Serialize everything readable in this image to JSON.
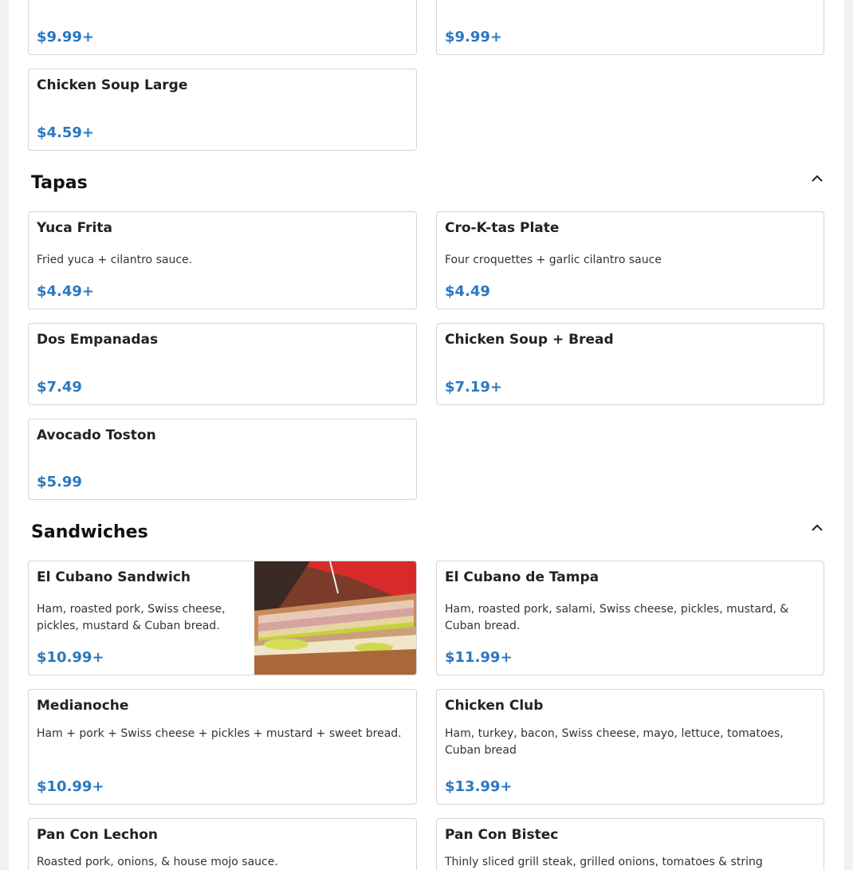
{
  "top_cards": [
    {
      "price": "$9.99+"
    },
    {
      "price": "$9.99+"
    }
  ],
  "soups_extra": {
    "name": "Chicken Soup Large",
    "price": "$4.59+"
  },
  "tapas": {
    "title": "Tapas",
    "items": [
      {
        "name": "Yuca Frita",
        "desc": "Fried yuca + cilantro sauce.",
        "price": "$4.49+"
      },
      {
        "name": "Cro-K-tas Plate",
        "desc": "Four croquettes + garlic cilantro sauce",
        "price": "$4.49"
      },
      {
        "name": "Dos Empanadas",
        "desc": "",
        "price": "$7.49"
      },
      {
        "name": "Chicken Soup + Bread",
        "desc": "",
        "price": "$7.19+"
      },
      {
        "name": "Avocado Toston",
        "desc": "",
        "price": "$5.99"
      }
    ]
  },
  "sandwiches": {
    "title": "Sandwiches",
    "items": [
      {
        "name": "El Cubano Sandwich",
        "desc": "Ham, roasted pork, Swiss cheese, pickles, mustard & Cuban bread.",
        "price": "$10.99+"
      },
      {
        "name": "El Cubano de Tampa",
        "desc": "Ham, roasted pork, salami, Swiss cheese, pickles, mustard, & Cuban bread.",
        "price": "$11.99+"
      },
      {
        "name": "Medianoche",
        "desc": "Ham + pork + Swiss cheese + pickles + mustard + sweet bread.",
        "price": "$10.99+"
      },
      {
        "name": "Chicken Club",
        "desc": "Ham, turkey, bacon, Swiss cheese, mayo, lettuce, tomatoes, Cuban bread",
        "price": "$13.99+"
      },
      {
        "name": "Pan Con Lechon",
        "desc": "Roasted pork, onions, & house mojo sauce.",
        "price": ""
      },
      {
        "name": "Pan Con Bistec",
        "desc": "Thinly sliced grill steak, grilled onions, tomatoes & string",
        "price": ""
      }
    ]
  },
  "icons": {
    "collapse": "chevron-up-icon",
    "photo": "cuban-sandwich-photo"
  },
  "colors": {
    "price": "#2a78c0",
    "border": "#d4d4d4"
  }
}
